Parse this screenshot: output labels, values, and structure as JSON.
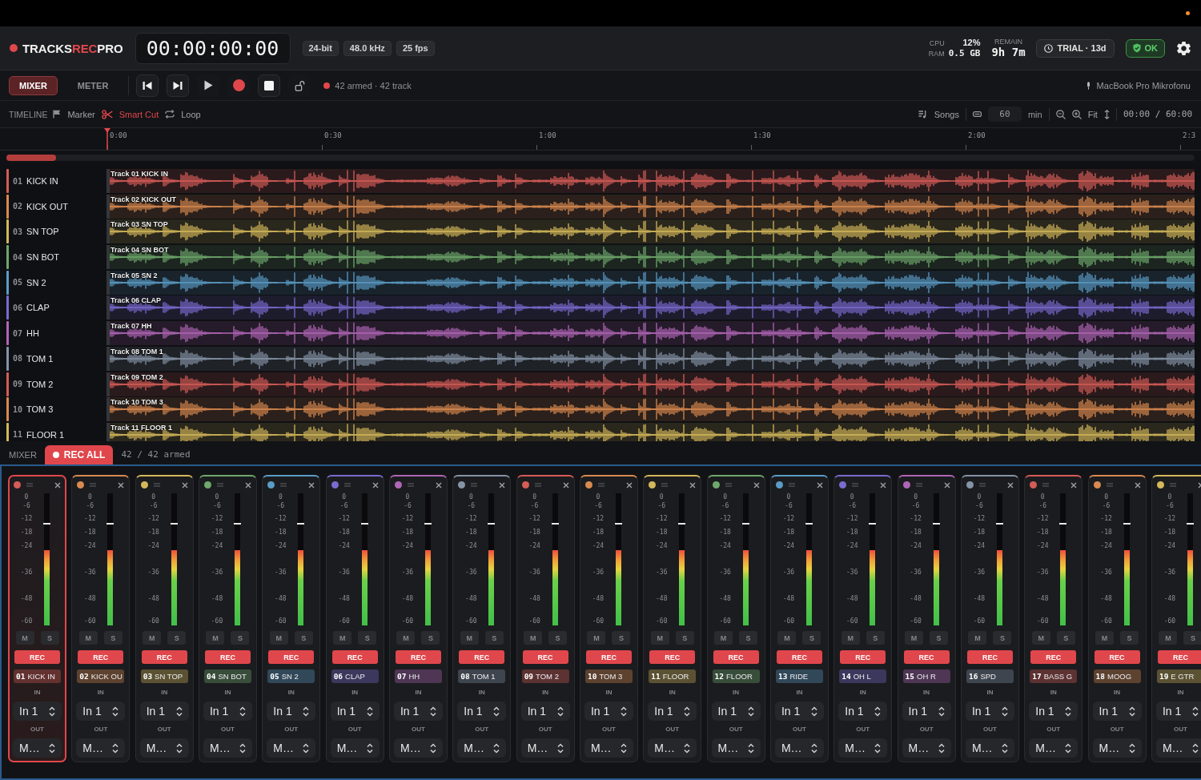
{
  "header": {
    "logo": {
      "lead": "TRACKS",
      "accent": "REC",
      "tail": "PRO"
    },
    "timecode": "00:00:00:00",
    "format_badges": [
      "24-bit",
      "48.0 kHz",
      "25 fps"
    ],
    "cpu": {
      "label": "CPU",
      "value": "12%"
    },
    "ram": {
      "label": "RAM",
      "value": "0.5 GB"
    },
    "remain": {
      "label": "REMAIN",
      "value": "9h 7m"
    },
    "trial": "TRIAL · 13d",
    "health": "OK"
  },
  "toolbar": {
    "tabs": [
      {
        "label": "MIXER",
        "selected": true
      },
      {
        "label": "METER",
        "selected": false
      }
    ],
    "armed_status": "42 armed · 42 track",
    "input_device": "MacBook Pro Mikrofonu"
  },
  "timeline_bar": {
    "label": "TIMELINE",
    "tools": [
      {
        "kind": "marker",
        "label": "Marker",
        "active": false
      },
      {
        "kind": "cut",
        "label": "Smart Cut",
        "active": true
      },
      {
        "kind": "loop",
        "label": "Loop",
        "active": false
      }
    ],
    "songs": "Songs",
    "length": {
      "value": "60",
      "unit": "min"
    },
    "fit": "Fit",
    "position": "00:00 / 60:00"
  },
  "ruler": {
    "labels": [
      "0:00",
      "0:30",
      "1:00",
      "1:30",
      "2:00",
      "2:3"
    ]
  },
  "tracks": [
    {
      "number": "01",
      "name": "KICK IN",
      "clip": "Track 01 KICK IN",
      "color": "#d65c57"
    },
    {
      "number": "02",
      "name": "KICK OUT",
      "clip": "Track 02 KICK OUT",
      "color": "#d98a50"
    },
    {
      "number": "03",
      "name": "SN TOP",
      "clip": "Track 03 SN TOP",
      "color": "#d4b85a"
    },
    {
      "number": "04",
      "name": "SN BOT",
      "clip": "Track 04 SN BOT",
      "color": "#6fa86c"
    },
    {
      "number": "05",
      "name": "SN 2",
      "clip": "Track 05 SN 2",
      "color": "#5b9cc6"
    },
    {
      "number": "06",
      "name": "CLAP",
      "clip": "Track 06 CLAP",
      "color": "#7b6ad0"
    },
    {
      "number": "07",
      "name": "HH",
      "clip": "Track 07 HH",
      "color": "#b066b6"
    },
    {
      "number": "08",
      "name": "TOM 1",
      "clip": "Track 08 TOM 1",
      "color": "#8593a6"
    },
    {
      "number": "09",
      "name": "TOM 2",
      "clip": "Track 09 TOM 2",
      "color": "#d65c57"
    },
    {
      "number": "10",
      "name": "TOM 3",
      "clip": "Track 10 TOM 3",
      "color": "#d98a50"
    },
    {
      "number": "11",
      "name": "FLOOR 1",
      "clip": "Track 11 FLOOR 1",
      "color": "#d4b85a"
    }
  ],
  "mixer_bar": {
    "label": "MIXER",
    "rec_all": "REC ALL",
    "armed": "42 / 42 armed"
  },
  "strips": [
    {
      "number": "01",
      "name": "KICK IN",
      "color": "#d65c57",
      "selected": true,
      "scale": [
        "0",
        "-6",
        "-12",
        "-18",
        "-24",
        "-36",
        "-48",
        "-60"
      ],
      "meter": {
        "level": 0.57
      },
      "peak": {
        "level": 0.77
      },
      "mute": "M",
      "muted": false,
      "solo": "S",
      "soloed": false,
      "rec": "REC",
      "armed": true,
      "in_label": "IN",
      "input": "In 1",
      "out_label": "OUT",
      "output": "M…"
    },
    {
      "number": "02",
      "name": "KICK OU",
      "color": "#d98a50",
      "selected": false,
      "scale": [
        "0",
        "-6",
        "-12",
        "-18",
        "-24",
        "-36",
        "-48",
        "-60"
      ],
      "meter": {
        "level": 0.57
      },
      "peak": {
        "level": 0.77
      },
      "mute": "M",
      "muted": false,
      "solo": "S",
      "soloed": false,
      "rec": "REC",
      "armed": true,
      "in_label": "IN",
      "input": "In 1",
      "out_label": "OUT",
      "output": "M…"
    },
    {
      "number": "03",
      "name": "SN TOP",
      "color": "#d4b85a",
      "selected": false,
      "scale": [
        "0",
        "-6",
        "-12",
        "-18",
        "-24",
        "-36",
        "-48",
        "-60"
      ],
      "meter": {
        "level": 0.57
      },
      "peak": {
        "level": 0.77
      },
      "mute": "M",
      "muted": false,
      "solo": "S",
      "soloed": false,
      "rec": "REC",
      "armed": true,
      "in_label": "IN",
      "input": "In 1",
      "out_label": "OUT",
      "output": "M…"
    },
    {
      "number": "04",
      "name": "SN BOT",
      "color": "#6fa86c",
      "selected": false,
      "scale": [
        "0",
        "-6",
        "-12",
        "-18",
        "-24",
        "-36",
        "-48",
        "-60"
      ],
      "meter": {
        "level": 0.57
      },
      "peak": {
        "level": 0.77
      },
      "mute": "M",
      "muted": false,
      "solo": "S",
      "soloed": false,
      "rec": "REC",
      "armed": true,
      "in_label": "IN",
      "input": "In 1",
      "out_label": "OUT",
      "output": "M…"
    },
    {
      "number": "05",
      "name": "SN 2",
      "color": "#5b9cc6",
      "selected": false,
      "scale": [
        "0",
        "-6",
        "-12",
        "-18",
        "-24",
        "-36",
        "-48",
        "-60"
      ],
      "meter": {
        "level": 0.57
      },
      "peak": {
        "level": 0.77
      },
      "mute": "M",
      "muted": false,
      "solo": "S",
      "soloed": false,
      "rec": "REC",
      "armed": true,
      "in_label": "IN",
      "input": "In 1",
      "out_label": "OUT",
      "output": "M…"
    },
    {
      "number": "06",
      "name": "CLAP",
      "color": "#7b6ad0",
      "selected": false,
      "scale": [
        "0",
        "-6",
        "-12",
        "-18",
        "-24",
        "-36",
        "-48",
        "-60"
      ],
      "meter": {
        "level": 0.57
      },
      "peak": {
        "level": 0.77
      },
      "mute": "M",
      "muted": false,
      "solo": "S",
      "soloed": false,
      "rec": "REC",
      "armed": true,
      "in_label": "IN",
      "input": "In 1",
      "out_label": "OUT",
      "output": "M…"
    },
    {
      "number": "07",
      "name": "HH",
      "color": "#b066b6",
      "selected": false,
      "scale": [
        "0",
        "-6",
        "-12",
        "-18",
        "-24",
        "-36",
        "-48",
        "-60"
      ],
      "meter": {
        "level": 0.57
      },
      "peak": {
        "level": 0.77
      },
      "mute": "M",
      "muted": false,
      "solo": "S",
      "soloed": false,
      "rec": "REC",
      "armed": true,
      "in_label": "IN",
      "input": "In 1",
      "out_label": "OUT",
      "output": "M…"
    },
    {
      "number": "08",
      "name": "TOM 1",
      "color": "#8593a6",
      "selected": false,
      "scale": [
        "0",
        "-6",
        "-12",
        "-18",
        "-24",
        "-36",
        "-48",
        "-60"
      ],
      "meter": {
        "level": 0.57
      },
      "peak": {
        "level": 0.77
      },
      "mute": "M",
      "muted": false,
      "solo": "S",
      "soloed": false,
      "rec": "REC",
      "armed": true,
      "in_label": "IN",
      "input": "In 1",
      "out_label": "OUT",
      "output": "M…"
    },
    {
      "number": "09",
      "name": "TOM 2",
      "color": "#d65c57",
      "selected": false,
      "scale": [
        "0",
        "-6",
        "-12",
        "-18",
        "-24",
        "-36",
        "-48",
        "-60"
      ],
      "meter": {
        "level": 0.57
      },
      "peak": {
        "level": 0.77
      },
      "mute": "M",
      "muted": false,
      "solo": "S",
      "soloed": false,
      "rec": "REC",
      "armed": true,
      "in_label": "IN",
      "input": "In 1",
      "out_label": "OUT",
      "output": "M…"
    },
    {
      "number": "10",
      "name": "TOM 3",
      "color": "#d98a50",
      "selected": false,
      "scale": [
        "0",
        "-6",
        "-12",
        "-18",
        "-24",
        "-36",
        "-48",
        "-60"
      ],
      "meter": {
        "level": 0.57
      },
      "peak": {
        "level": 0.77
      },
      "mute": "M",
      "muted": false,
      "solo": "S",
      "soloed": false,
      "rec": "REC",
      "armed": true,
      "in_label": "IN",
      "input": "In 1",
      "out_label": "OUT",
      "output": "M…"
    },
    {
      "number": "11",
      "name": "FLOOR",
      "color": "#d4b85a",
      "selected": false,
      "scale": [
        "0",
        "-6",
        "-12",
        "-18",
        "-24",
        "-36",
        "-48",
        "-60"
      ],
      "meter": {
        "level": 0.57
      },
      "peak": {
        "level": 0.77
      },
      "mute": "M",
      "muted": false,
      "solo": "S",
      "soloed": false,
      "rec": "REC",
      "armed": true,
      "in_label": "IN",
      "input": "In 1",
      "out_label": "OUT",
      "output": "M…"
    },
    {
      "number": "12",
      "name": "FLOOR",
      "color": "#6fa86c",
      "selected": false,
      "scale": [
        "0",
        "-6",
        "-12",
        "-18",
        "-24",
        "-36",
        "-48",
        "-60"
      ],
      "meter": {
        "level": 0.57
      },
      "peak": {
        "level": 0.77
      },
      "mute": "M",
      "muted": false,
      "solo": "S",
      "soloed": false,
      "rec": "REC",
      "armed": true,
      "in_label": "IN",
      "input": "In 1",
      "out_label": "OUT",
      "output": "M…"
    },
    {
      "number": "13",
      "name": "RIDE",
      "color": "#5b9cc6",
      "selected": false,
      "scale": [
        "0",
        "-6",
        "-12",
        "-18",
        "-24",
        "-36",
        "-48",
        "-60"
      ],
      "meter": {
        "level": 0.57
      },
      "peak": {
        "level": 0.77
      },
      "mute": "M",
      "muted": false,
      "solo": "S",
      "soloed": false,
      "rec": "REC",
      "armed": true,
      "in_label": "IN",
      "input": "In 1",
      "out_label": "OUT",
      "output": "M…"
    },
    {
      "number": "14",
      "name": "OH L",
      "color": "#7b6ad0",
      "selected": false,
      "scale": [
        "0",
        "-6",
        "-12",
        "-18",
        "-24",
        "-36",
        "-48",
        "-60"
      ],
      "meter": {
        "level": 0.57
      },
      "peak": {
        "level": 0.77
      },
      "mute": "M",
      "muted": false,
      "solo": "S",
      "soloed": false,
      "rec": "REC",
      "armed": true,
      "in_label": "IN",
      "input": "In 1",
      "out_label": "OUT",
      "output": "M…"
    },
    {
      "number": "15",
      "name": "OH R",
      "color": "#b066b6",
      "selected": false,
      "scale": [
        "0",
        "-6",
        "-12",
        "-18",
        "-24",
        "-36",
        "-48",
        "-60"
      ],
      "meter": {
        "level": 0.57
      },
      "peak": {
        "level": 0.77
      },
      "mute": "M",
      "muted": false,
      "solo": "S",
      "soloed": false,
      "rec": "REC",
      "armed": true,
      "in_label": "IN",
      "input": "In 1",
      "out_label": "OUT",
      "output": "M…"
    },
    {
      "number": "16",
      "name": "SPD",
      "color": "#8593a6",
      "selected": false,
      "scale": [
        "0",
        "-6",
        "-12",
        "-18",
        "-24",
        "-36",
        "-48",
        "-60"
      ],
      "meter": {
        "level": 0.57
      },
      "peak": {
        "level": 0.77
      },
      "mute": "M",
      "muted": false,
      "solo": "S",
      "soloed": false,
      "rec": "REC",
      "armed": true,
      "in_label": "IN",
      "input": "In 1",
      "out_label": "OUT",
      "output": "M…"
    },
    {
      "number": "17",
      "name": "BASS G",
      "color": "#d65c57",
      "selected": false,
      "scale": [
        "0",
        "-6",
        "-12",
        "-18",
        "-24",
        "-36",
        "-48",
        "-60"
      ],
      "meter": {
        "level": 0.57
      },
      "peak": {
        "level": 0.77
      },
      "mute": "M",
      "muted": false,
      "solo": "S",
      "soloed": false,
      "rec": "REC",
      "armed": true,
      "in_label": "IN",
      "input": "In 1",
      "out_label": "OUT",
      "output": "M…"
    },
    {
      "number": "18",
      "name": "MOOG",
      "color": "#d98a50",
      "selected": false,
      "scale": [
        "0",
        "-6",
        "-12",
        "-18",
        "-24",
        "-36",
        "-48",
        "-60"
      ],
      "meter": {
        "level": 0.57
      },
      "peak": {
        "level": 0.77
      },
      "mute": "M",
      "muted": false,
      "solo": "S",
      "soloed": false,
      "rec": "REC",
      "armed": true,
      "in_label": "IN",
      "input": "In 1",
      "out_label": "OUT",
      "output": "M…"
    },
    {
      "number": "19",
      "name": "E GTR",
      "color": "#d4b85a",
      "selected": false,
      "scale": [
        "0",
        "-6",
        "-12",
        "-18",
        "-24",
        "-36",
        "-48",
        "-60"
      ],
      "meter": {
        "level": 0.57
      },
      "peak": {
        "level": 0.77
      },
      "mute": "M",
      "muted": false,
      "solo": "S",
      "soloed": false,
      "rec": "REC",
      "armed": true,
      "in_label": "IN",
      "input": "In 1",
      "out_label": "OUT",
      "output": "M…"
    }
  ]
}
